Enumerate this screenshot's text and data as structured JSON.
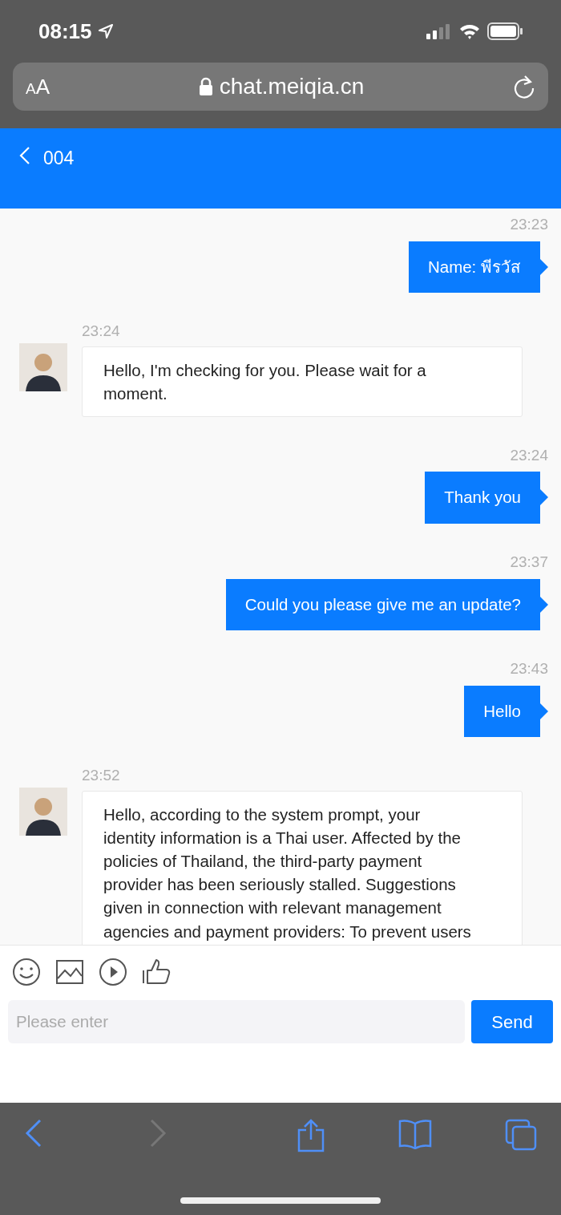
{
  "status_bar": {
    "time": "08:15"
  },
  "address_bar": {
    "text_size_label": "AA",
    "url": "chat.meiqia.cn"
  },
  "header": {
    "title": "004"
  },
  "messages": [
    {
      "kind": "sent",
      "time": "23:23",
      "text": "Name: พีรวัส"
    },
    {
      "kind": "received",
      "time": "23:24",
      "text": "Hello, I'm checking for you. Please wait for a moment."
    },
    {
      "kind": "sent",
      "time": "23:24",
      "text": "Thank you"
    },
    {
      "kind": "sent",
      "time": "23:37",
      "text": "Could you please give me an update?"
    },
    {
      "kind": "sent",
      "time": "23:43",
      "text": "Hello"
    },
    {
      "kind": "received",
      "time": "23:52",
      "text": "Hello, according to the system prompt, your identity information is a Thai user. Affected by the policies of Thailand, the third-party payment provider has been seriously stalled. Suggestions given in connection with relevant management agencies and payment providers: To prevent users"
    }
  ],
  "composer": {
    "placeholder": "Please enter",
    "send_label": "Send"
  },
  "browser_toolbar": {
    "back_disabled": false,
    "forward_disabled": true
  }
}
